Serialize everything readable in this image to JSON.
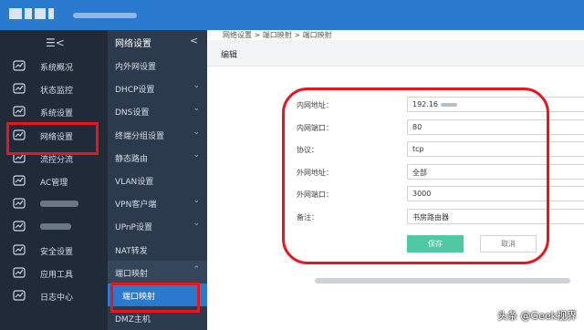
{
  "breadcrumb": "网络设置 > 端口映射 > 端口映射",
  "page_title": "编辑",
  "menu_toggle_glyph": "☰<",
  "sidebar_main": [
    {
      "label": "系统概况",
      "icon": "speedometer-icon"
    },
    {
      "label": "状态监控",
      "icon": "monitor-chart-icon"
    },
    {
      "label": "系统设置",
      "icon": "gear-icon"
    },
    {
      "label": "网络设置",
      "icon": "network-icon"
    },
    {
      "label": "流控分流",
      "icon": "traffic-icon"
    },
    {
      "label": "AC管理",
      "icon": "ac-icon"
    },
    {
      "label": "",
      "icon": "grid-icon"
    },
    {
      "label": "",
      "icon": "transfer-icon"
    },
    {
      "label": "安全设置",
      "icon": "security-icon"
    },
    {
      "label": "应用工具",
      "icon": "apps-icon"
    },
    {
      "label": "日志中心",
      "icon": "log-icon"
    }
  ],
  "sidebar_sub": {
    "title": "网络设置",
    "collapse_glyph": "<",
    "items": [
      {
        "label": "内外网设置",
        "chevron": ""
      },
      {
        "label": "DHCP设置",
        "chevron": "⌄"
      },
      {
        "label": "DNS设置",
        "chevron": "⌄"
      },
      {
        "label": "终端分组设置",
        "chevron": "⌄"
      },
      {
        "label": "静态路由",
        "chevron": "⌄"
      },
      {
        "label": "VLAN设置",
        "chevron": ""
      },
      {
        "label": "VPN客户端",
        "chevron": "⌄"
      },
      {
        "label": "UPnP设置",
        "chevron": "⌄"
      },
      {
        "label": "NAT转发",
        "chevron": ""
      },
      {
        "label": "端口映射",
        "chevron": "⌃"
      },
      {
        "label": "端口映射",
        "chevron": ""
      },
      {
        "label": "DMZ主机",
        "chevron": ""
      }
    ]
  },
  "form": {
    "rows": [
      {
        "label": "内网地址：",
        "value": "192.16"
      },
      {
        "label": "内网端口：",
        "value": "80"
      },
      {
        "label": "协议：",
        "value": "tcp"
      },
      {
        "label": "外网地址：",
        "value": "全部"
      },
      {
        "label": "外网端口：",
        "value": "3000"
      },
      {
        "label": "备注：",
        "value": "书房路由器"
      }
    ],
    "save_label": "保存",
    "cancel_label": "取消"
  },
  "watermark": "头条 @Geek视界",
  "colors": {
    "topbar": "#2a7bd0",
    "sidebar": "#202a38",
    "subsidebar": "#2b3a4c",
    "active": "#2a7bd0",
    "save": "#4fc8a4",
    "highlight": "#e8151f"
  }
}
